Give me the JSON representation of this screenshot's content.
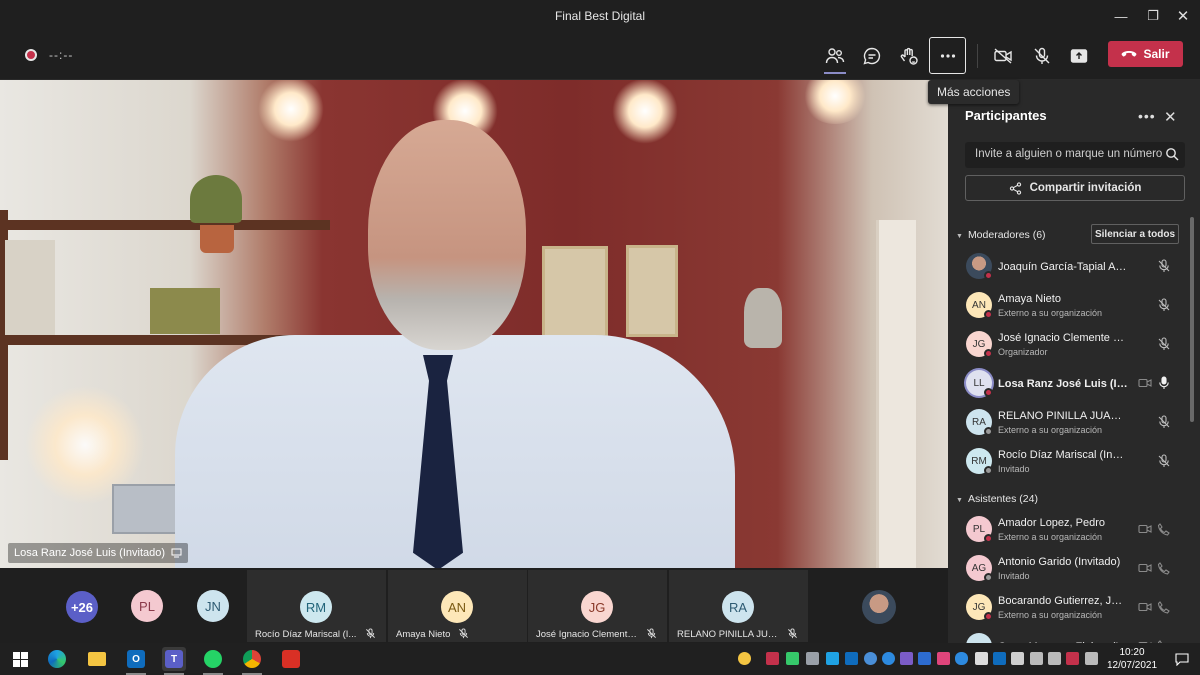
{
  "window": {
    "title": "Final Best Digital"
  },
  "toolbar": {
    "timer": "--:--",
    "leave_label": "Salir",
    "tooltip": "Más acciones"
  },
  "stage": {
    "speaker_label": "Losa Ranz José Luis (Invitado)"
  },
  "gallery": {
    "overflow_count": "+26",
    "small_avatars": [
      {
        "initials": "PL",
        "color": "#f4c9d0"
      },
      {
        "initials": "JN",
        "color": "#cde4ee"
      }
    ],
    "tiles": [
      {
        "initials": "RM",
        "name": "Rocío Díaz Mariscal (I...",
        "color": "#cde8ef"
      },
      {
        "initials": "AN",
        "name": "Amaya Nieto",
        "color": "#fde7b8"
      },
      {
        "initials": "JG",
        "name": "José Ignacio Clemente...",
        "color": "#f9d6d0"
      },
      {
        "initials": "RA",
        "name": "RELANO PINILLA JUA...",
        "color": "#cde4ee"
      }
    ]
  },
  "panel": {
    "title": "Participantes",
    "search_placeholder": "Invite a alguien o marque un número",
    "share_label": "Compartir invitación",
    "moderators_header": "Moderadores (6)",
    "mute_all_label": "Silenciar a todos",
    "attendees_header": "Asistentes (24)",
    "moderators": [
      {
        "initials": "",
        "name": "Joaquín García-Tapial Arregui",
        "sub": "",
        "photo": true,
        "color": "#5a6b7a",
        "status": "#c4314b"
      },
      {
        "initials": "AN",
        "name": "Amaya Nieto",
        "sub": "Externo a su organización",
        "color": "#fde7b8",
        "status": "#c4314b"
      },
      {
        "initials": "JG",
        "name": "José Ignacio Clemente Gonzál...",
        "sub": "Organizador",
        "color": "#f9d6d0",
        "status": "#c4314b"
      },
      {
        "initials": "LL",
        "name": "Losa Ranz José Luis (Invi...",
        "sub": "",
        "color": "#dfe1ef",
        "status": "#c4314b",
        "speaking": true
      },
      {
        "initials": "RA",
        "name": "RELANO PINILLA JUAN ANTO...",
        "sub": "Externo a su organización",
        "color": "#cde4ee",
        "status": "#9a9a9a"
      },
      {
        "initials": "RM",
        "name": "Rocío Díaz Mariscal (Invitado)",
        "sub": "Invitado",
        "color": "#cde8ef",
        "status": "#9a9a9a"
      }
    ],
    "attendees": [
      {
        "initials": "PL",
        "name": "Amador Lopez, Pedro",
        "sub": "Externo a su organización",
        "color": "#f4c9d0",
        "status": "#c4314b"
      },
      {
        "initials": "AG",
        "name": "Antonio Garido (Invitado)",
        "sub": "Invitado",
        "color": "#f4c9d0",
        "status": "#9a9a9a"
      },
      {
        "initials": "JG",
        "name": "Bocarando Gutierrez, Jos...",
        "sub": "Externo a su organización",
        "color": "#fde7b8",
        "status": "#c4314b"
      },
      {
        "initials": "",
        "name": "Curro Moreno - Zinkee (I...",
        "sub": "",
        "color": "#cde4ee",
        "status": "#9a9a9a"
      }
    ]
  },
  "taskbar": {
    "time": "10:20",
    "date": "12/07/2021"
  },
  "colors": {
    "accent": "#6264a7",
    "leave": "#c4314b",
    "panel_bg": "#292929",
    "toolbar_bg": "#1f1f1f"
  }
}
